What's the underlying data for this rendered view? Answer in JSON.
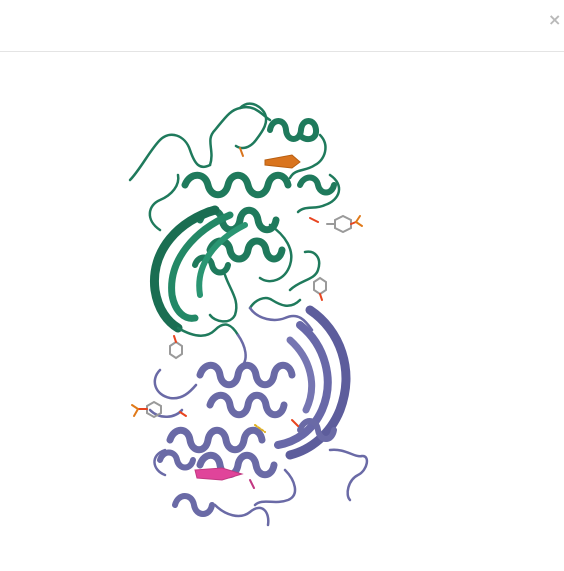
{
  "dialog": {
    "close_label": "×"
  },
  "structure": {
    "chains": [
      {
        "color": "#1f7a5c"
      },
      {
        "color": "#6a6aa6"
      }
    ],
    "highlight_colors": {
      "strand_top": "#d9741e",
      "strand_bottom": "#e0449a",
      "ligand_carbon": "#9a9a9a",
      "ligand_oxygen": "#e8441f",
      "ligand_phosphorus": "#e07a1a"
    }
  }
}
